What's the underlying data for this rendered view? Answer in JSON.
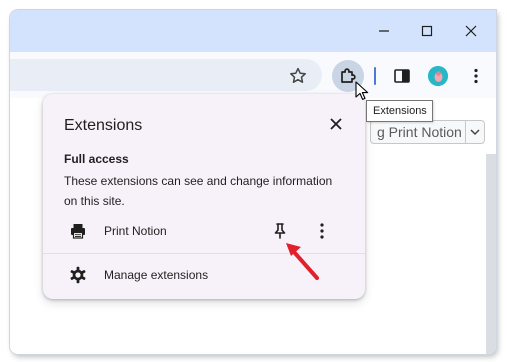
{
  "window": {
    "controls": [
      "minimize",
      "maximize",
      "close"
    ]
  },
  "toolbar": {
    "icons": [
      "star-icon",
      "puzzle-icon",
      "side-panel-icon",
      "avatar",
      "kebab-menu-icon"
    ],
    "accent": "#d3e3fd"
  },
  "page": {
    "button_label": "g Print Notion"
  },
  "tooltip": {
    "text": "Extensions"
  },
  "popup": {
    "title": "Extensions",
    "section_title": "Full access",
    "section_desc": "These extensions can see and change information on this site.",
    "extension": {
      "name": "Print Notion",
      "icon": "printer-icon"
    },
    "manage_label": "Manage extensions"
  },
  "annotation": {
    "color": "#e0202a"
  }
}
